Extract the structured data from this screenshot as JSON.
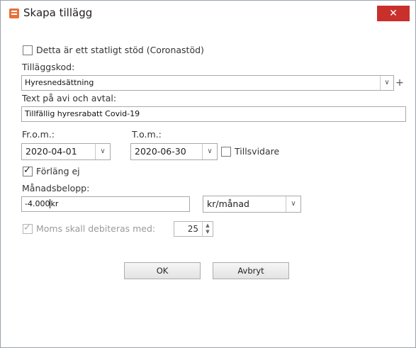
{
  "window": {
    "title": "Skapa tillägg",
    "close_symbol": "✕"
  },
  "form": {
    "statligt_stod": {
      "label": "Detta är ett statligt stöd (Coronastöd)",
      "checked": false
    },
    "tillaggskod": {
      "label": "Tilläggskod:",
      "value": "Hyresnedsättning",
      "add_symbol": "+"
    },
    "avi_text": {
      "label": "Text på avi och avtal:",
      "value": "Tillfällig hyresrabatt Covid-19"
    },
    "from_date": {
      "label": "Fr.o.m.:",
      "value": "2020-04-01"
    },
    "to_date": {
      "label": "T.o.m.:",
      "value": "2020-06-30"
    },
    "tillsvidare": {
      "label": "Tillsvidare",
      "checked": false
    },
    "forlang": {
      "label": "Förläng ej",
      "checked": true
    },
    "manadsbelopp": {
      "label": "Månadsbelopp:",
      "value_number": "-4.000",
      "value_unit": "kr"
    },
    "period": {
      "value": "kr/månad"
    },
    "moms": {
      "label": "Moms skall debiteras med:",
      "checked": true,
      "disabled": true,
      "value": "25"
    }
  },
  "buttons": {
    "ok": "OK",
    "cancel": "Avbryt"
  },
  "icons": {
    "dropdown": "∨",
    "spin_up": "▲",
    "spin_down": "▼"
  },
  "colors": {
    "close_button": "#c9302c",
    "app_icon": "#e8703a"
  }
}
